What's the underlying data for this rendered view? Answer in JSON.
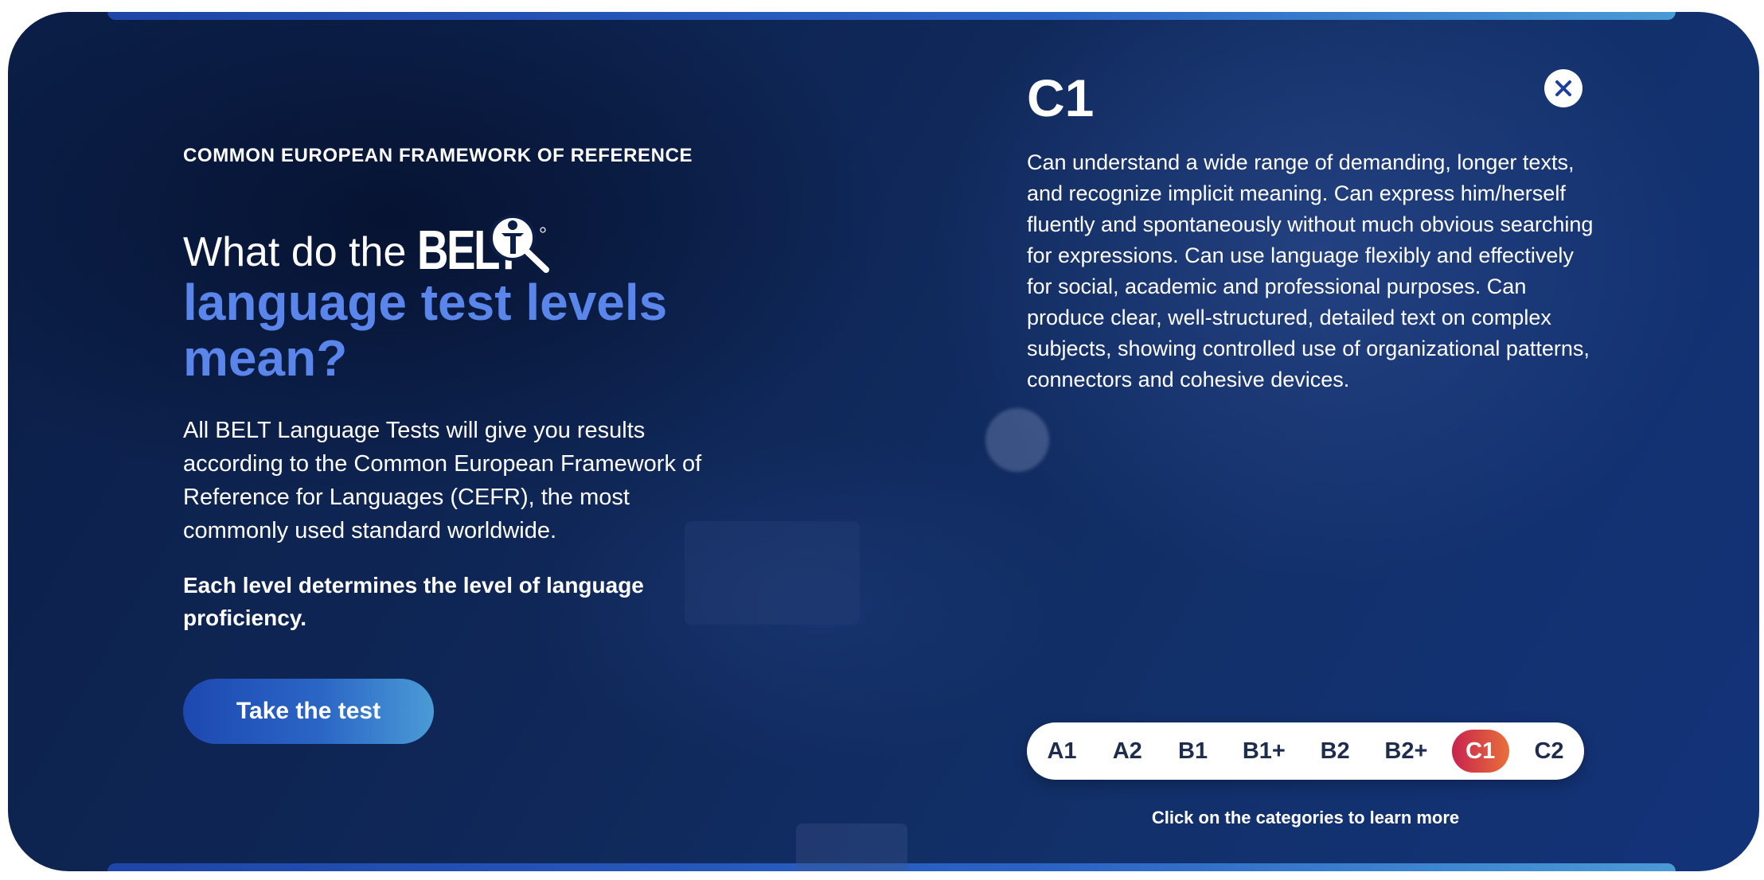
{
  "theme": {
    "accent": "#5a86ec",
    "active_gradient_start": "#c8234e",
    "active_gradient_end": "#e8703a",
    "background": "#0f2757"
  },
  "intro_section": {
    "eyebrow": "COMMON EUROPEAN FRAMEWORK OF REFERENCE",
    "heading_prefix": "What do the",
    "logo_text": "BELT",
    "heading_accent": "language test levels mean?",
    "body": "All BELT Language Tests will give you results according to the Common European Framework of Reference for Languages (CEFR), the most commonly used standard worldwide.",
    "emphasis": "Each level determines the level of language proficiency.",
    "cta_label": "Take the test"
  },
  "level_detail": {
    "title": "C1",
    "description": "Can understand a wide range of demanding, longer texts, and recognize implicit meaning. Can express him/herself fluently and spontaneously without much obvious searching for expressions. Can use language flexibly and effectively for social, academic and professional purposes. Can produce clear, well-structured, detailed text on complex subjects, showing controlled use of organizational patterns, connectors and cohesive devices.",
    "close_icon": "close-icon"
  },
  "level_picker": {
    "levels": [
      "A1",
      "A2",
      "B1",
      "B1+",
      "B2",
      "B2+",
      "C1",
      "C2"
    ],
    "selected": "C1",
    "hint": "Click on the categories to learn more"
  }
}
